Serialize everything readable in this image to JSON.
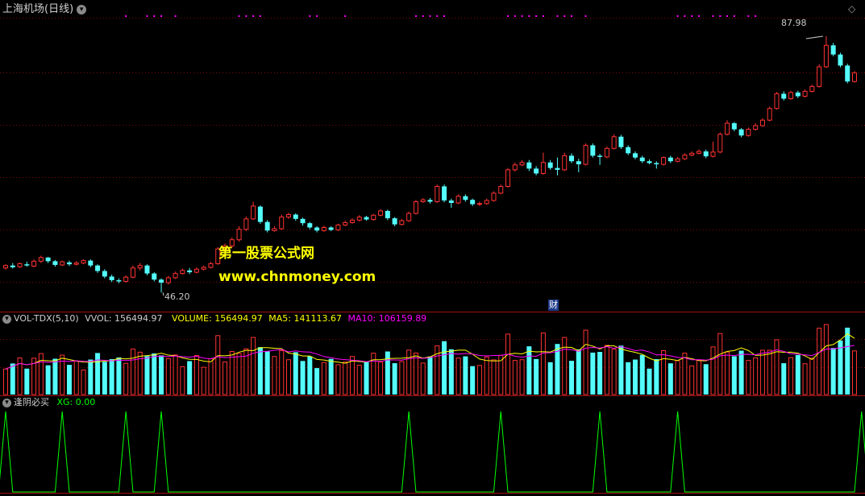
{
  "main_panel": {
    "title": "上海机场(日线)",
    "collapse_icon": "chevron-down-icon",
    "corner_icon": "diamond-icon",
    "high_label": "87.98",
    "low_label": "46.20",
    "cai_marker": "财"
  },
  "watermark": {
    "line1": "第一股票公式网",
    "line2": "www.chnmoney.com"
  },
  "volume_panel": {
    "indicator": "VOL-TDX(5,10)",
    "vvol": "VVOL: 156494.97",
    "volume": "VOLUME: 156494.97",
    "ma5": "MA5: 141113.67",
    "ma10": "MA10: 106159.89",
    "colors": {
      "vvol": "#cfcfcf",
      "volume": "#ffff00",
      "ma5": "#ffff00",
      "ma10": "#ff00ff"
    }
  },
  "signal_panel": {
    "indicator": "逢阴必买",
    "xg": "XG: 0.00",
    "color": "#00ff00"
  },
  "chart_data": {
    "type": "candlestick",
    "price_range": [
      44,
      91
    ],
    "high": 87.98,
    "low": 46.2,
    "candles": [
      [
        50.2,
        50.6,
        50.8,
        49.9
      ],
      [
        50.6,
        50.3,
        51.0,
        50.1
      ],
      [
        50.4,
        50.9,
        51.1,
        50.2
      ],
      [
        50.8,
        50.6,
        51.2,
        50.4
      ],
      [
        50.5,
        51.3,
        51.6,
        50.3
      ],
      [
        51.3,
        51.9,
        52.2,
        51.0
      ],
      [
        51.9,
        51.3,
        52.0,
        51.0
      ],
      [
        51.3,
        50.7,
        51.5,
        50.4
      ],
      [
        50.7,
        51.2,
        51.4,
        50.5
      ],
      [
        51.1,
        50.8,
        51.4,
        50.5
      ],
      [
        50.8,
        51.0,
        51.3,
        50.6
      ],
      [
        51.0,
        51.4,
        51.6,
        50.8
      ],
      [
        51.4,
        50.6,
        51.6,
        50.3
      ],
      [
        50.6,
        49.7,
        50.8,
        49.4
      ],
      [
        49.7,
        48.8,
        50.0,
        48.5
      ],
      [
        48.8,
        48.2,
        49.1,
        47.9
      ],
      [
        48.2,
        48.0,
        48.5,
        47.7
      ],
      [
        48.0,
        48.7,
        49.0,
        47.8
      ],
      [
        48.7,
        50.2,
        50.6,
        48.5
      ],
      [
        50.2,
        50.6,
        51.0,
        49.8
      ],
      [
        50.6,
        49.3,
        50.8,
        49.0
      ],
      [
        49.3,
        48.3,
        49.5,
        48.0
      ],
      [
        48.3,
        47.8,
        48.5,
        46.2
      ],
      [
        47.8,
        48.6,
        48.9,
        47.5
      ],
      [
        48.6,
        49.3,
        49.6,
        48.4
      ],
      [
        49.3,
        49.8,
        50.1,
        49.1
      ],
      [
        49.8,
        49.5,
        50.2,
        49.2
      ],
      [
        49.5,
        50.0,
        50.3,
        49.3
      ],
      [
        50.0,
        50.3,
        50.6,
        49.8
      ],
      [
        50.3,
        50.9,
        51.2,
        50.1
      ],
      [
        50.9,
        53.3,
        53.6,
        50.7
      ],
      [
        53.3,
        53.8,
        54.2,
        53.0
      ],
      [
        53.8,
        54.8,
        55.2,
        53.5
      ],
      [
        54.8,
        56.5,
        57.0,
        54.5
      ],
      [
        56.5,
        58.2,
        58.6,
        56.2
      ],
      [
        58.2,
        60.3,
        61.0,
        58.0
      ],
      [
        60.2,
        57.7,
        60.4,
        57.4
      ],
      [
        57.7,
        56.3,
        58.0,
        56.0
      ],
      [
        56.3,
        56.6,
        57.0,
        56.1
      ],
      [
        56.6,
        58.5,
        58.9,
        56.4
      ],
      [
        58.5,
        58.9,
        59.2,
        58.2
      ],
      [
        58.9,
        58.2,
        59.1,
        57.9
      ],
      [
        58.2,
        57.5,
        58.4,
        57.1
      ],
      [
        57.5,
        56.8,
        57.7,
        56.5
      ],
      [
        56.8,
        56.3,
        57.0,
        56.0
      ],
      [
        56.3,
        56.8,
        57.1,
        56.1
      ],
      [
        56.8,
        56.4,
        57.0,
        56.2
      ],
      [
        56.4,
        57.2,
        57.4,
        56.2
      ],
      [
        57.2,
        57.6,
        57.9,
        57.0
      ],
      [
        57.6,
        58.0,
        58.3,
        57.4
      ],
      [
        58.0,
        58.5,
        58.8,
        57.8
      ],
      [
        58.5,
        58.1,
        58.7,
        57.9
      ],
      [
        58.1,
        58.8,
        59.0,
        57.9
      ],
      [
        58.8,
        59.5,
        59.8,
        58.6
      ],
      [
        59.5,
        58.3,
        59.7,
        58.0
      ],
      [
        58.3,
        57.3,
        58.5,
        57.0
      ],
      [
        57.3,
        57.9,
        58.2,
        57.1
      ],
      [
        57.9,
        59.1,
        59.4,
        57.7
      ],
      [
        59.1,
        61.0,
        61.3,
        58.9
      ],
      [
        61.0,
        61.3,
        61.6,
        60.8
      ],
      [
        61.3,
        61.0,
        61.6,
        60.7
      ],
      [
        61.0,
        63.5,
        63.8,
        60.8
      ],
      [
        63.5,
        61.2,
        63.8,
        60.9
      ],
      [
        61.2,
        60.8,
        61.5,
        60.0
      ],
      [
        60.8,
        61.9,
        62.2,
        60.6
      ],
      [
        61.9,
        61.3,
        62.2,
        61.0
      ],
      [
        61.3,
        60.6,
        61.5,
        60.3
      ],
      [
        60.6,
        60.7,
        61.0,
        60.3
      ],
      [
        60.7,
        61.2,
        61.5,
        60.5
      ],
      [
        61.2,
        62.4,
        62.7,
        61.0
      ],
      [
        62.4,
        63.5,
        63.8,
        62.2
      ],
      [
        63.5,
        66.2,
        66.5,
        63.3
      ],
      [
        66.2,
        67.0,
        67.4,
        65.9
      ],
      [
        67.0,
        67.4,
        67.8,
        66.8
      ],
      [
        67.4,
        66.4,
        67.8,
        66.0
      ],
      [
        66.4,
        65.6,
        66.8,
        65.3
      ],
      [
        65.6,
        67.4,
        69.0,
        65.4
      ],
      [
        67.4,
        66.5,
        67.8,
        66.2
      ],
      [
        66.5,
        66.2,
        68.2,
        65.3
      ],
      [
        66.2,
        68.5,
        69.0,
        66.0
      ],
      [
        68.5,
        67.6,
        68.9,
        67.3
      ],
      [
        67.6,
        67.1,
        68.0,
        65.8
      ],
      [
        67.1,
        70.2,
        70.5,
        66.9
      ],
      [
        70.2,
        68.5,
        70.5,
        68.2
      ],
      [
        68.5,
        68.3,
        68.8,
        67.0
      ],
      [
        68.3,
        69.7,
        70.0,
        68.1
      ],
      [
        69.7,
        71.6,
        72.0,
        69.5
      ],
      [
        71.6,
        69.9,
        71.9,
        69.6
      ],
      [
        69.9,
        68.9,
        70.2,
        68.6
      ],
      [
        68.9,
        68.2,
        69.2,
        67.9
      ],
      [
        68.2,
        67.6,
        68.5,
        67.3
      ],
      [
        67.6,
        67.3,
        67.9,
        67.1
      ],
      [
        67.3,
        67.1,
        67.6,
        66.4
      ],
      [
        67.1,
        68.2,
        68.4,
        66.9
      ],
      [
        68.2,
        67.6,
        68.5,
        67.3
      ],
      [
        67.6,
        68.0,
        68.3,
        67.4
      ],
      [
        68.0,
        68.6,
        68.9,
        67.8
      ],
      [
        68.6,
        68.9,
        69.2,
        68.4
      ],
      [
        68.9,
        69.2,
        69.5,
        68.7
      ],
      [
        69.2,
        68.4,
        69.5,
        68.1
      ],
      [
        68.4,
        69.1,
        70.8,
        68.2
      ],
      [
        69.1,
        72.0,
        72.3,
        68.9
      ],
      [
        72.0,
        73.8,
        74.3,
        71.8
      ],
      [
        73.8,
        72.8,
        74.0,
        72.5
      ],
      [
        72.8,
        71.8,
        73.0,
        71.5
      ],
      [
        71.8,
        72.8,
        73.1,
        71.6
      ],
      [
        72.8,
        73.4,
        73.8,
        72.6
      ],
      [
        73.4,
        74.3,
        74.6,
        73.2
      ],
      [
        74.3,
        76.2,
        76.5,
        74.1
      ],
      [
        76.2,
        78.6,
        78.9,
        76.0
      ],
      [
        78.6,
        77.8,
        79.0,
        77.5
      ],
      [
        77.8,
        78.8,
        79.1,
        77.6
      ],
      [
        78.8,
        78.2,
        79.1,
        77.9
      ],
      [
        78.2,
        79.0,
        79.3,
        78.0
      ],
      [
        79.0,
        79.8,
        80.1,
        78.8
      ],
      [
        79.8,
        83.0,
        83.4,
        79.6
      ],
      [
        83.0,
        86.5,
        87.98,
        82.8
      ],
      [
        86.5,
        85.0,
        86.9,
        84.7
      ],
      [
        85.0,
        83.2,
        85.3,
        82.9
      ],
      [
        83.2,
        80.6,
        83.5,
        80.3
      ],
      [
        80.6,
        82.0,
        82.3,
        80.4
      ]
    ],
    "volume": {
      "labels": [
        "VVOL",
        "VOLUME",
        "MA5",
        "MA10"
      ],
      "values": [
        156494.97,
        156494.97,
        141113.67,
        106159.89
      ]
    },
    "xg_signal_days": [
      0,
      8,
      17,
      22,
      57,
      70,
      84,
      95,
      121
    ],
    "dots_days": [
      17,
      20,
      21,
      22,
      24,
      33,
      34,
      35,
      36,
      43,
      44,
      48,
      58,
      59,
      60,
      61,
      62,
      71,
      72,
      73,
      74,
      75,
      76,
      78,
      79,
      80,
      82,
      95,
      96,
      97,
      98,
      100,
      101,
      102,
      103,
      105,
      106
    ]
  }
}
